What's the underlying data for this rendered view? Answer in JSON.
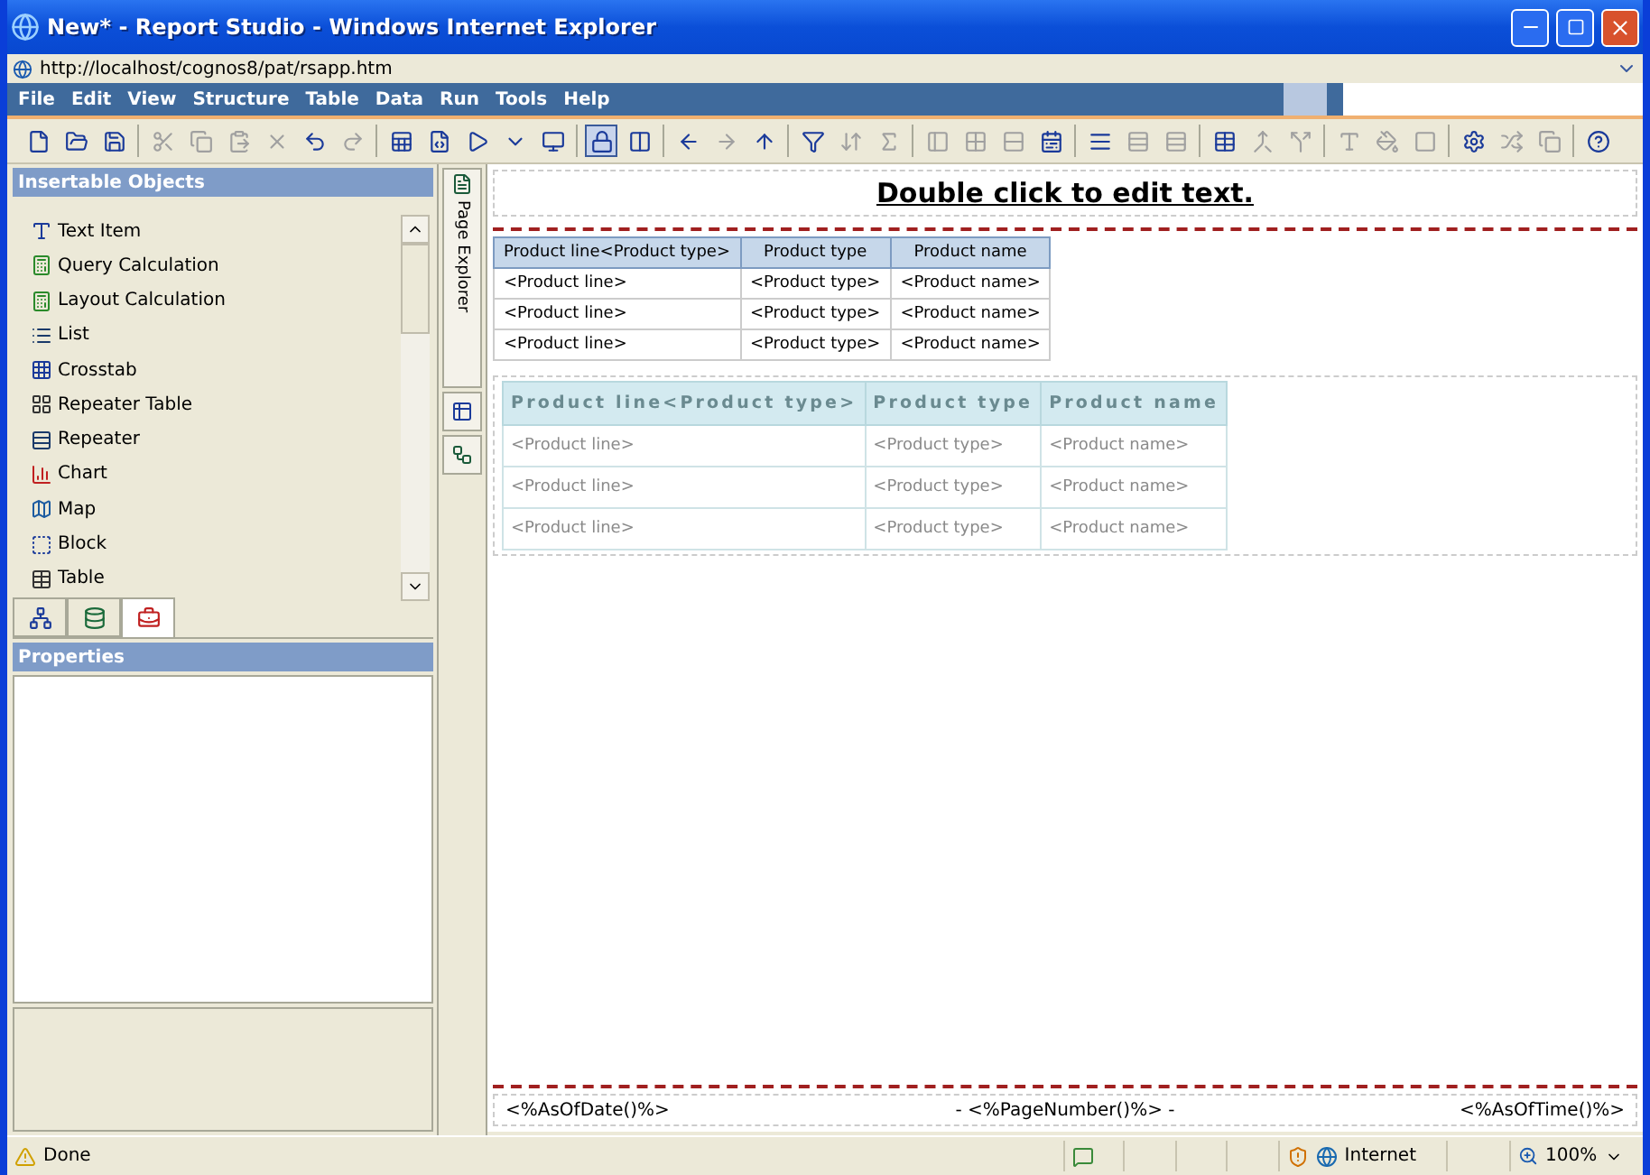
{
  "window": {
    "title": "New* - Report Studio - Windows Internet Explorer"
  },
  "address": "http://localhost/cognos8/pat/rsapp.htm",
  "menu": [
    "File",
    "Edit",
    "View",
    "Structure",
    "Table",
    "Data",
    "Run",
    "Tools",
    "Help"
  ],
  "toolbar": [
    [
      {
        "disabled": false,
        "pressed": false
      },
      {
        "disabled": false,
        "pressed": false
      },
      {
        "disabled": false,
        "pressed": false
      }
    ],
    [
      {
        "disabled": true,
        "pressed": false
      },
      {
        "disabled": true,
        "pressed": false
      },
      {
        "disabled": true,
        "pressed": false
      },
      {
        "disabled": true,
        "pressed": false
      },
      {
        "disabled": false,
        "pressed": false
      },
      {
        "disabled": true,
        "pressed": false
      }
    ],
    [
      {
        "disabled": false,
        "pressed": false
      },
      {
        "disabled": false,
        "pressed": false
      },
      {
        "disabled": false,
        "pressed": false
      },
      {
        "disabled": false,
        "pressed": false
      },
      {
        "disabled": false,
        "pressed": false
      }
    ],
    [
      {
        "disabled": false,
        "pressed": true
      },
      {
        "disabled": false,
        "pressed": false
      }
    ],
    [
      {
        "disabled": false,
        "pressed": false
      },
      {
        "disabled": true,
        "pressed": false
      },
      {
        "disabled": false,
        "pressed": false
      }
    ],
    [
      {
        "disabled": false,
        "pressed": false
      },
      {
        "disabled": true,
        "pressed": false
      },
      {
        "disabled": true,
        "pressed": false
      }
    ],
    [
      {
        "disabled": true,
        "pressed": false
      },
      {
        "disabled": true,
        "pressed": false
      },
      {
        "disabled": true,
        "pressed": false
      },
      {
        "disabled": false,
        "pressed": false
      }
    ],
    [
      {
        "disabled": false,
        "pressed": false
      },
      {
        "disabled": true,
        "pressed": false
      },
      {
        "disabled": true,
        "pressed": false
      }
    ],
    [
      {
        "disabled": false,
        "pressed": false
      },
      {
        "disabled": true,
        "pressed": false
      },
      {
        "disabled": true,
        "pressed": false
      }
    ],
    [
      {
        "disabled": true,
        "pressed": false
      },
      {
        "disabled": true,
        "pressed": false
      },
      {
        "disabled": true,
        "pressed": false
      }
    ],
    [
      {
        "disabled": false,
        "pressed": false
      },
      {
        "disabled": true,
        "pressed": false
      },
      {
        "disabled": true,
        "pressed": false
      }
    ],
    [
      {
        "disabled": false,
        "pressed": false
      }
    ]
  ],
  "insertable": {
    "title": "Insertable Objects",
    "items": [
      "Text Item",
      "Query Calculation",
      "Layout Calculation",
      "List",
      "Crosstab",
      "Repeater Table",
      "Repeater",
      "Chart",
      "Map",
      "Block",
      "Table"
    ],
    "tabs": [
      {
        "selected": false
      },
      {
        "selected": false
      },
      {
        "selected": true
      }
    ]
  },
  "properties": {
    "title": "Properties"
  },
  "explorer": {
    "label": "Page Explorer"
  },
  "report": {
    "header": "Double click to edit text.",
    "list": {
      "columns": [
        "Product line<Product type>",
        "Product type",
        "Product name"
      ],
      "rows": [
        [
          "<Product line>",
          "<Product type>",
          "<Product name>"
        ],
        [
          "<Product line>",
          "<Product type>",
          "<Product name>"
        ],
        [
          "<Product line>",
          "<Product type>",
          "<Product name>"
        ]
      ]
    },
    "styled_list": {
      "columns": [
        "Product line<Product type>",
        "Product type",
        "Product name"
      ],
      "rows": [
        [
          "<Product line>",
          "<Product type>",
          "<Product name>"
        ],
        [
          "<Product line>",
          "<Product type>",
          "<Product name>"
        ],
        [
          "<Product line>",
          "<Product type>",
          "<Product name>"
        ]
      ]
    },
    "footer": [
      "<%AsOfDate()%>",
      "-  <%PageNumber()%>  -",
      "<%AsOfTime()%>"
    ]
  },
  "status_bar": {
    "text": "Done",
    "zone": "Internet",
    "zoom": "100%"
  }
}
